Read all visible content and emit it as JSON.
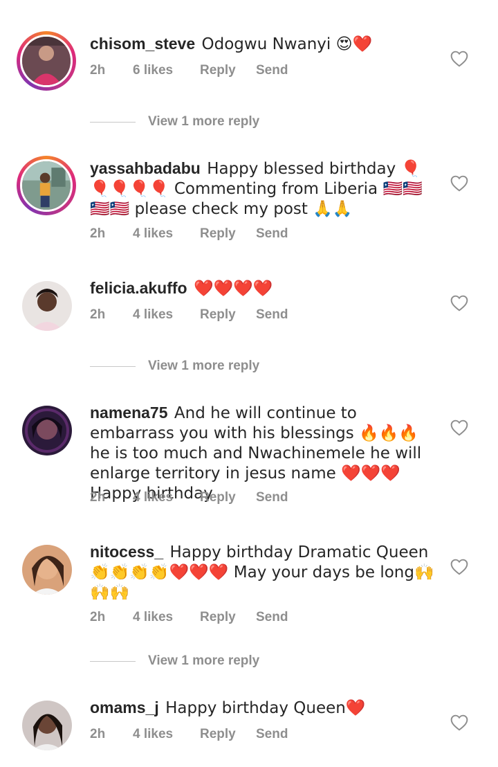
{
  "comments": [
    {
      "username": "chisom_steve",
      "text": "Odogwu Nwanyi 😍❤️",
      "time": "2h",
      "likes": "6 likes",
      "reply": "Reply",
      "send": "Send",
      "view_more": "View 1 more reply"
    },
    {
      "username": "yassahbadabu",
      "text": "Happy blessed birthday 🎈🎈🎈🎈🎈 Commenting from Liberia 🇱🇷🇱🇷🇱🇷🇱🇷 please check my post 🙏🙏",
      "time": "2h",
      "likes": "4 likes",
      "reply": "Reply",
      "send": "Send"
    },
    {
      "username": "felicia.akuffo",
      "text": "❤️❤️❤️❤️",
      "time": "2h",
      "likes": "4 likes",
      "reply": "Reply",
      "send": "Send",
      "view_more": "View 1 more reply"
    },
    {
      "username": "namena75",
      "text": "And he will  continue  to embarrass you with his blessings 🔥🔥🔥he is too much and Nwachinemele he will enlarge territory in jesus  name ❤️❤️❤️Happy birthday",
      "time": "2h",
      "likes": "4 likes",
      "reply": "Reply",
      "send": "Send"
    },
    {
      "username": "nitocess_",
      "text": "Happy birthday Dramatic Queen👏👏👏👏❤️❤️❤️ May your days be long🙌🙌🙌",
      "time": "2h",
      "likes": "4 likes",
      "reply": "Reply",
      "send": "Send",
      "view_more": "View 1 more reply"
    },
    {
      "username": "omams_j",
      "text": "Happy birthday Queen❤️",
      "time": "2h",
      "likes": "4 likes",
      "reply": "Reply",
      "send": "Send"
    }
  ],
  "colors": {
    "muted": "#8e8e8e",
    "text": "#262626",
    "story_ring": "#dd2a7b"
  },
  "icons": {
    "like": "heart-outline-icon"
  }
}
